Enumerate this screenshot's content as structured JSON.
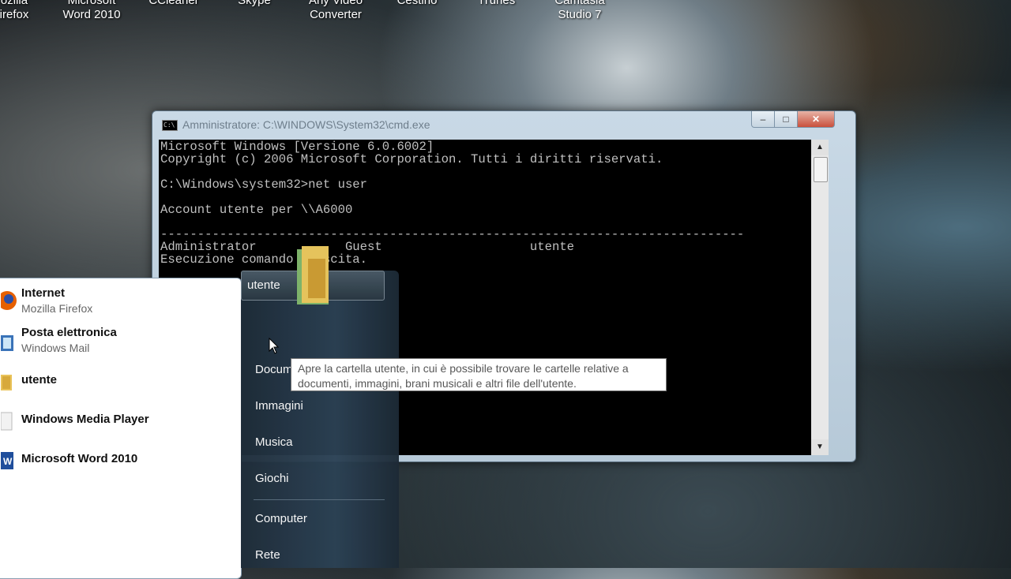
{
  "desktop_icons": [
    {
      "label": "ozilla\nirefox"
    },
    {
      "label": "Microsoft\nWord 2010"
    },
    {
      "label": "CCleaner"
    },
    {
      "label": "Skype"
    },
    {
      "label": "Any Video\nConverter"
    },
    {
      "label": "Cestino"
    },
    {
      "label": "iTunes"
    },
    {
      "label": "Camtasia\nStudio 7"
    }
  ],
  "cmd": {
    "title": "Amministratore: C:\\WINDOWS\\System32\\cmd.exe",
    "lines": [
      "Microsoft Windows [Versione 6.0.6002]",
      "Copyright (c) 2006 Microsoft Corporation. Tutti i diritti riservati.",
      "",
      "C:\\Windows\\system32>net user",
      "",
      "Account utente per \\\\A6000",
      "",
      "-------------------------------------------------------------------------------",
      "Administrator            Guest                    utente",
      "Esecuzione comando riuscita."
    ]
  },
  "start_menu": {
    "programs": [
      {
        "title": "Internet",
        "subtitle": "Mozilla Firefox",
        "icon": "firefox-icon"
      },
      {
        "title": "Posta elettronica",
        "subtitle": "Windows Mail",
        "icon": "mail-icon"
      },
      {
        "title": "utente",
        "subtitle": "",
        "icon": "user-folder-icon"
      },
      {
        "title": "Windows Media Player",
        "subtitle": "",
        "icon": "media-player-icon"
      },
      {
        "title": "Microsoft Word 2010",
        "subtitle": "",
        "icon": "word-icon"
      }
    ],
    "right": {
      "utente": "utente",
      "documenti": "Docum",
      "immagini": "Immagini",
      "musica": "Musica",
      "giochi": "Giochi",
      "computer": "Computer",
      "rete": "Rete"
    },
    "tooltip": "Apre la cartella utente, in cui è possibile trovare le cartelle relative a documenti, immagini, brani musicali e altri file dell'utente."
  }
}
